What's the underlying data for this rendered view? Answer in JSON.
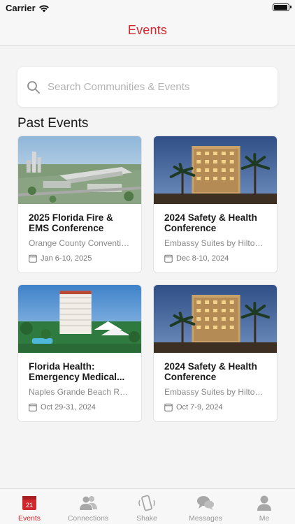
{
  "status_bar": {
    "carrier": "Carrier"
  },
  "header": {
    "title": "Events"
  },
  "search": {
    "placeholder": "Search Communities & Events"
  },
  "section": {
    "title": "Past Events"
  },
  "events": [
    {
      "title": "2025 Florida Fire & EMS Conference",
      "venue": "Orange County Conventio...",
      "date": "Jan 6-10, 2025"
    },
    {
      "title": "2024 Safety & Health Conference",
      "venue": "Embassy Suites by Hilton ...",
      "date": "Dec 8-10, 2024"
    },
    {
      "title": "Florida Health: Emergency Medical...",
      "venue": "Naples Grande Beach Resort",
      "date": "Oct 29-31, 2024"
    },
    {
      "title": "2024 Safety & Health Conference",
      "venue": "Embassy Suites by Hilton ...",
      "date": "Oct 7-9, 2024"
    }
  ],
  "tabs": [
    {
      "label": "Events",
      "icon": "calendar-icon",
      "badge": "21",
      "active": true
    },
    {
      "label": "Connections",
      "icon": "people-icon"
    },
    {
      "label": "Shake",
      "icon": "shake-phone-icon"
    },
    {
      "label": "Messages",
      "icon": "chat-bubbles-icon"
    },
    {
      "label": "Me",
      "icon": "person-icon"
    }
  ],
  "colors": {
    "accent": "#d0282e",
    "background": "#f4f4f4",
    "card": "#ffffff",
    "muted_text": "#8a8a8a"
  }
}
